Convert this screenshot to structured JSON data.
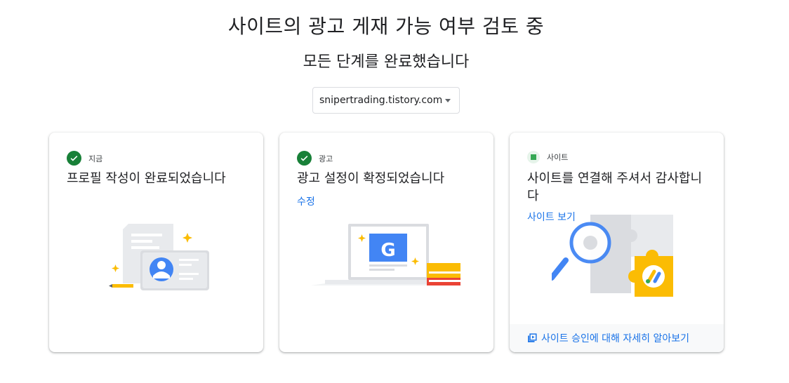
{
  "header": {
    "title": "사이트의 광고 게재 가능 여부 검토 중",
    "subtitle": "모든 단계를 완료했습니다"
  },
  "site_select": {
    "value": "snipertrading.tistory.com"
  },
  "cards": [
    {
      "status_label": "지금",
      "status_icon": "check-circle-icon",
      "heading": "프로필 작성이 완료되었습니다",
      "illustration": "profile-card-illustration"
    },
    {
      "status_label": "광고",
      "status_icon": "check-circle-icon",
      "heading": "광고 설정이 확정되었습니다",
      "link": "수정",
      "illustration": "laptop-google-illustration"
    },
    {
      "status_label": "사이트",
      "status_icon": "green-square-icon",
      "heading": "사이트를 연결해 주셔서 감사합니다",
      "link": "사이트 보기",
      "footer_link": "사이트 승인에 대해 자세히 알아보기",
      "footer_icon": "video-library-icon",
      "illustration": "puzzle-magnifier-illustration"
    }
  ],
  "colors": {
    "success_green": "#188038",
    "link_blue": "#1a73e8",
    "google_blue": "#4285f4",
    "yellow": "#fbbc04",
    "red": "#ea4335"
  }
}
